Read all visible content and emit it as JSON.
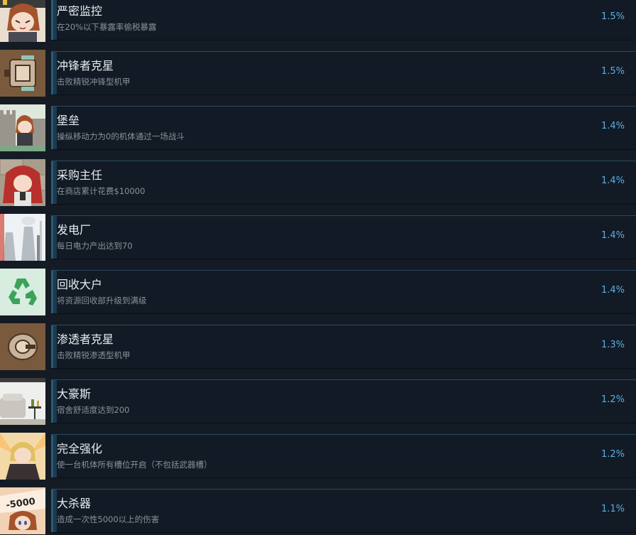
{
  "achievements": [
    {
      "name": "严密监控",
      "desc": "在20%以下暴露率偷税暴露",
      "pct": "1.5%",
      "icon": "anime-girl-watch-icon"
    },
    {
      "name": "冲锋者克星",
      "desc": "击败精锐冲锋型机甲",
      "pct": "1.5%",
      "icon": "mech-top-view-icon"
    },
    {
      "name": "堡垒",
      "desc": "操纵移动力为0的机体通过一场战斗",
      "pct": "1.4%",
      "icon": "castle-girl-icon"
    },
    {
      "name": "采购主任",
      "desc": "在商店累计花费$10000",
      "pct": "1.4%",
      "icon": "red-hair-girl-icon"
    },
    {
      "name": "发电厂",
      "desc": "每日电力产出达到70",
      "pct": "1.4%",
      "icon": "power-plant-icon"
    },
    {
      "name": "回收大户",
      "desc": "将资源回收部升级到满级",
      "pct": "1.4%",
      "icon": "recycle-icon"
    },
    {
      "name": "渗透者克星",
      "desc": "击败精锐渗透型机甲",
      "pct": "1.3%",
      "icon": "drone-top-view-icon"
    },
    {
      "name": "大豪斯",
      "desc": "宿舍舒适度达到200",
      "pct": "1.2%",
      "icon": "living-room-icon"
    },
    {
      "name": "完全强化",
      "desc": "使一台机体所有槽位开启（不包括武器槽）",
      "pct": "1.2%",
      "icon": "blonde-girl-icon"
    },
    {
      "name": "大杀器",
      "desc": "造成一次性5000以上的伤害",
      "pct": "1.1%",
      "icon": "damage-5000-icon",
      "icon_text": "-5000"
    }
  ],
  "colors": {
    "background": "#141b24",
    "bar": "#121a25",
    "accent": "#1b3a4e",
    "percent": "#5aaee5"
  }
}
